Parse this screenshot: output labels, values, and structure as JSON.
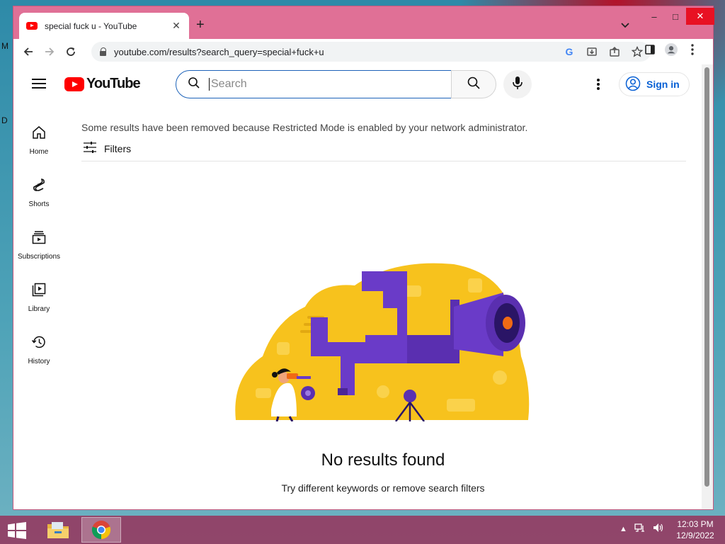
{
  "desktop": {
    "letters": [
      "M",
      "D"
    ]
  },
  "browser": {
    "tab_title": "special fuck u - YouTube",
    "new_tab": "+",
    "url": "youtube.com/results?search_query=special+fuck+u",
    "window_controls": {
      "minimize": "–",
      "maximize": "□",
      "close": "✕"
    }
  },
  "youtube": {
    "logo_text": "YouTube",
    "search": {
      "placeholder": "Search",
      "value": ""
    },
    "signin_label": "Sign in",
    "sidebar": {
      "items": [
        {
          "label": "Home",
          "icon": "home-icon"
        },
        {
          "label": "Shorts",
          "icon": "shorts-icon"
        },
        {
          "label": "Subscriptions",
          "icon": "subscriptions-icon"
        },
        {
          "label": "Library",
          "icon": "library-icon"
        },
        {
          "label": "History",
          "icon": "history-icon"
        }
      ]
    },
    "notice": "Some results have been removed because Restricted Mode is enabled by your network administrator.",
    "filters_label": "Filters",
    "empty": {
      "title": "No results found",
      "subtitle": "Try different keywords or remove search filters"
    },
    "colors": {
      "brand_red": "#ff0000",
      "link_blue": "#065fd4",
      "illus_yellow": "#f7c21d",
      "illus_purple": "#6a3bc8",
      "illus_orange": "#f06a14"
    }
  },
  "taskbar": {
    "clock_time": "12:03 PM",
    "clock_date": "12/9/2022",
    "apps": [
      "file-explorer-icon",
      "chrome-icon"
    ]
  }
}
